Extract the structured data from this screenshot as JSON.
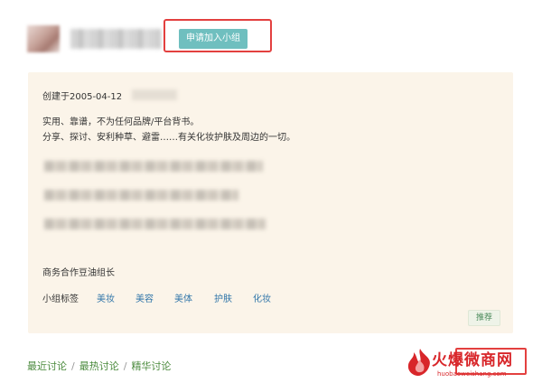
{
  "header": {
    "join_button_label": "申请加入小组"
  },
  "info": {
    "created_text": "创建于2005-04-12",
    "description_line1": "实用、靠谱，不为任何品牌/平台背书。",
    "description_line2": "分享、探讨、安利种草、避雷……有关化妆护肤及周边的一切。",
    "business_contact": "商务合作豆油组长",
    "tags_label": "小组标签",
    "tags": [
      "美妆",
      "美容",
      "美体",
      "护肤",
      "化妆"
    ],
    "recommend_label": "推荐"
  },
  "discussions": {
    "tabs": [
      "最近讨论",
      "最热讨论",
      "精华讨论"
    ],
    "separator": "/"
  },
  "watermark": {
    "brand": "火爆微商网",
    "url": "huobaoweishang.com"
  },
  "colors": {
    "join_button": "#6fbfbf",
    "highlight_outline": "#e3403f",
    "info_background": "#fbf4e9",
    "tag_link": "#3377aa",
    "nav_link": "#4a8a3c"
  }
}
